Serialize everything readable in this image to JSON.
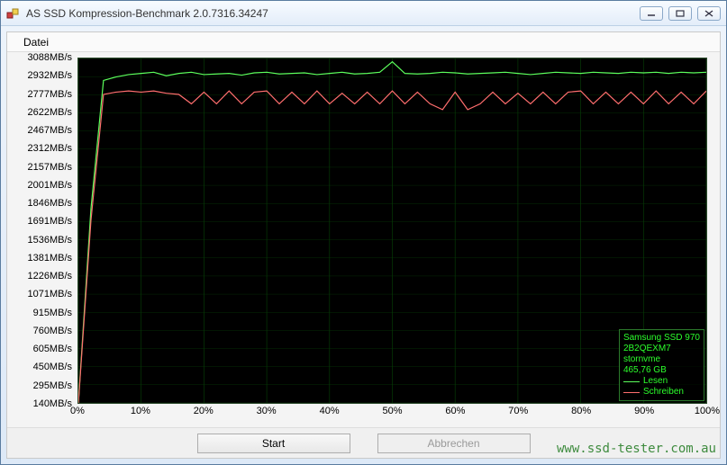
{
  "window": {
    "title": "AS SSD Kompression-Benchmark 2.0.7316.34247"
  },
  "menu": {
    "file": "Datei"
  },
  "buttons": {
    "start": "Start",
    "cancel": "Abbrechen"
  },
  "watermark": "www.ssd-tester.com.au",
  "legend": {
    "device": "Samsung SSD 970",
    "fw": "2B2QEXM7",
    "driver": "stornvme",
    "capacity": "465,76 GB",
    "read": "Lesen",
    "write": "Schreiben"
  },
  "chart_data": {
    "type": "line",
    "xlabel": "",
    "ylabel": "",
    "x_ticks": [
      "0%",
      "10%",
      "20%",
      "30%",
      "40%",
      "50%",
      "60%",
      "70%",
      "80%",
      "90%",
      "100%"
    ],
    "y_ticks": [
      "3088MB/s",
      "2932MB/s",
      "2777MB/s",
      "2622MB/s",
      "2467MB/s",
      "2312MB/s",
      "2157MB/s",
      "2001MB/s",
      "1846MB/s",
      "1691MB/s",
      "1536MB/s",
      "1381MB/s",
      "1226MB/s",
      "1071MB/s",
      "915MB/s",
      "760MB/s",
      "605MB/s",
      "450MB/s",
      "295MB/s",
      "140MB/s"
    ],
    "ylim": [
      140,
      3088
    ],
    "xlim": [
      0,
      100
    ],
    "x": [
      0,
      2,
      4,
      6,
      8,
      10,
      12,
      14,
      16,
      18,
      20,
      22,
      24,
      26,
      28,
      30,
      32,
      34,
      36,
      38,
      40,
      42,
      44,
      46,
      48,
      50,
      52,
      54,
      56,
      58,
      60,
      62,
      64,
      66,
      68,
      70,
      72,
      74,
      76,
      78,
      80,
      82,
      84,
      86,
      88,
      90,
      92,
      94,
      96,
      98,
      100
    ],
    "series": [
      {
        "name": "Lesen",
        "color": "#5cff5c",
        "values": [
          140,
          1800,
          2900,
          2930,
          2950,
          2960,
          2970,
          2940,
          2960,
          2970,
          2950,
          2955,
          2960,
          2945,
          2965,
          2970,
          2955,
          2960,
          2965,
          2950,
          2960,
          2970,
          2955,
          2960,
          2970,
          3060,
          2960,
          2955,
          2960,
          2970,
          2965,
          2955,
          2960,
          2965,
          2970,
          2960,
          2950,
          2960,
          2970,
          2965,
          2960,
          2970,
          2965,
          2960,
          2970,
          2965,
          2970,
          2960,
          2970,
          2965,
          2970
        ]
      },
      {
        "name": "Schreiben",
        "color": "#ff6e6e",
        "values": [
          140,
          1700,
          2780,
          2800,
          2810,
          2800,
          2810,
          2790,
          2780,
          2700,
          2800,
          2700,
          2810,
          2700,
          2800,
          2810,
          2700,
          2800,
          2700,
          2810,
          2700,
          2790,
          2700,
          2800,
          2700,
          2810,
          2700,
          2800,
          2700,
          2650,
          2800,
          2650,
          2700,
          2800,
          2700,
          2790,
          2700,
          2800,
          2700,
          2800,
          2810,
          2700,
          2800,
          2700,
          2800,
          2700,
          2810,
          2700,
          2800,
          2700,
          2810
        ]
      }
    ]
  }
}
